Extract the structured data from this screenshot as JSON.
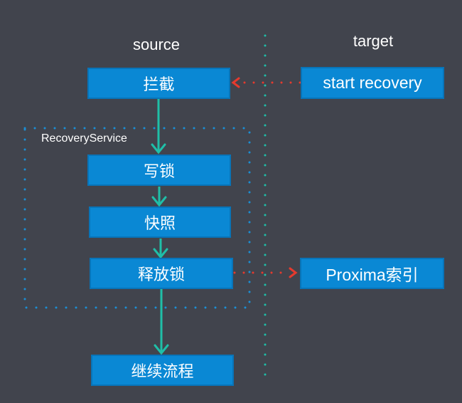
{
  "headings": {
    "source": "source",
    "target": "target"
  },
  "group": {
    "label": "RecoveryService"
  },
  "nodes": {
    "intercept": "拦截",
    "start_recovery": "start recovery",
    "write_lock": "写锁",
    "snapshot": "快照",
    "release_lock": "释放锁",
    "proxima_index": "Proxima索引",
    "continue_flow": "继续流程"
  },
  "colors": {
    "background": "#41444d",
    "node_fill": "#0a88d4",
    "flow_arrow": "#1fbfa8",
    "cross_arrow": "#e53a2e",
    "divider": "#1fbfa8",
    "group_border": "#1a8fd6"
  }
}
